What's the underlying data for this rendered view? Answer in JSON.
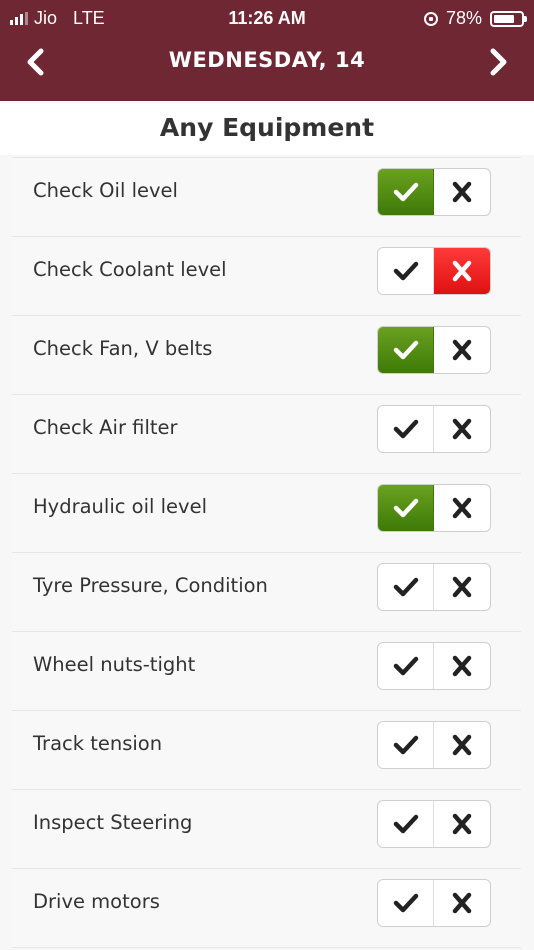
{
  "status_bar": {
    "carrier": "Jio",
    "network": "LTE",
    "time": "11:26 AM",
    "battery": "78%",
    "battery_level": 0.78
  },
  "nav": {
    "title": "WEDNESDAY,  14"
  },
  "section": {
    "title": "Any Equipment"
  },
  "colors": {
    "header": "#6e2733",
    "yes_active": "#4f8c12",
    "no_active": "#f42424"
  },
  "items": [
    {
      "label": "Check Oil level",
      "state": "yes"
    },
    {
      "label": "Check Coolant level",
      "state": "no"
    },
    {
      "label": "Check Fan, V belts",
      "state": "yes"
    },
    {
      "label": "Check Air filter",
      "state": "none"
    },
    {
      "label": "Hydraulic oil level",
      "state": "yes"
    },
    {
      "label": "Tyre Pressure, Condition",
      "state": "none"
    },
    {
      "label": "Wheel nuts-tight",
      "state": "none"
    },
    {
      "label": "Track tension",
      "state": "none"
    },
    {
      "label": "Inspect Steering",
      "state": "none"
    },
    {
      "label": "Drive motors",
      "state": "none"
    }
  ]
}
